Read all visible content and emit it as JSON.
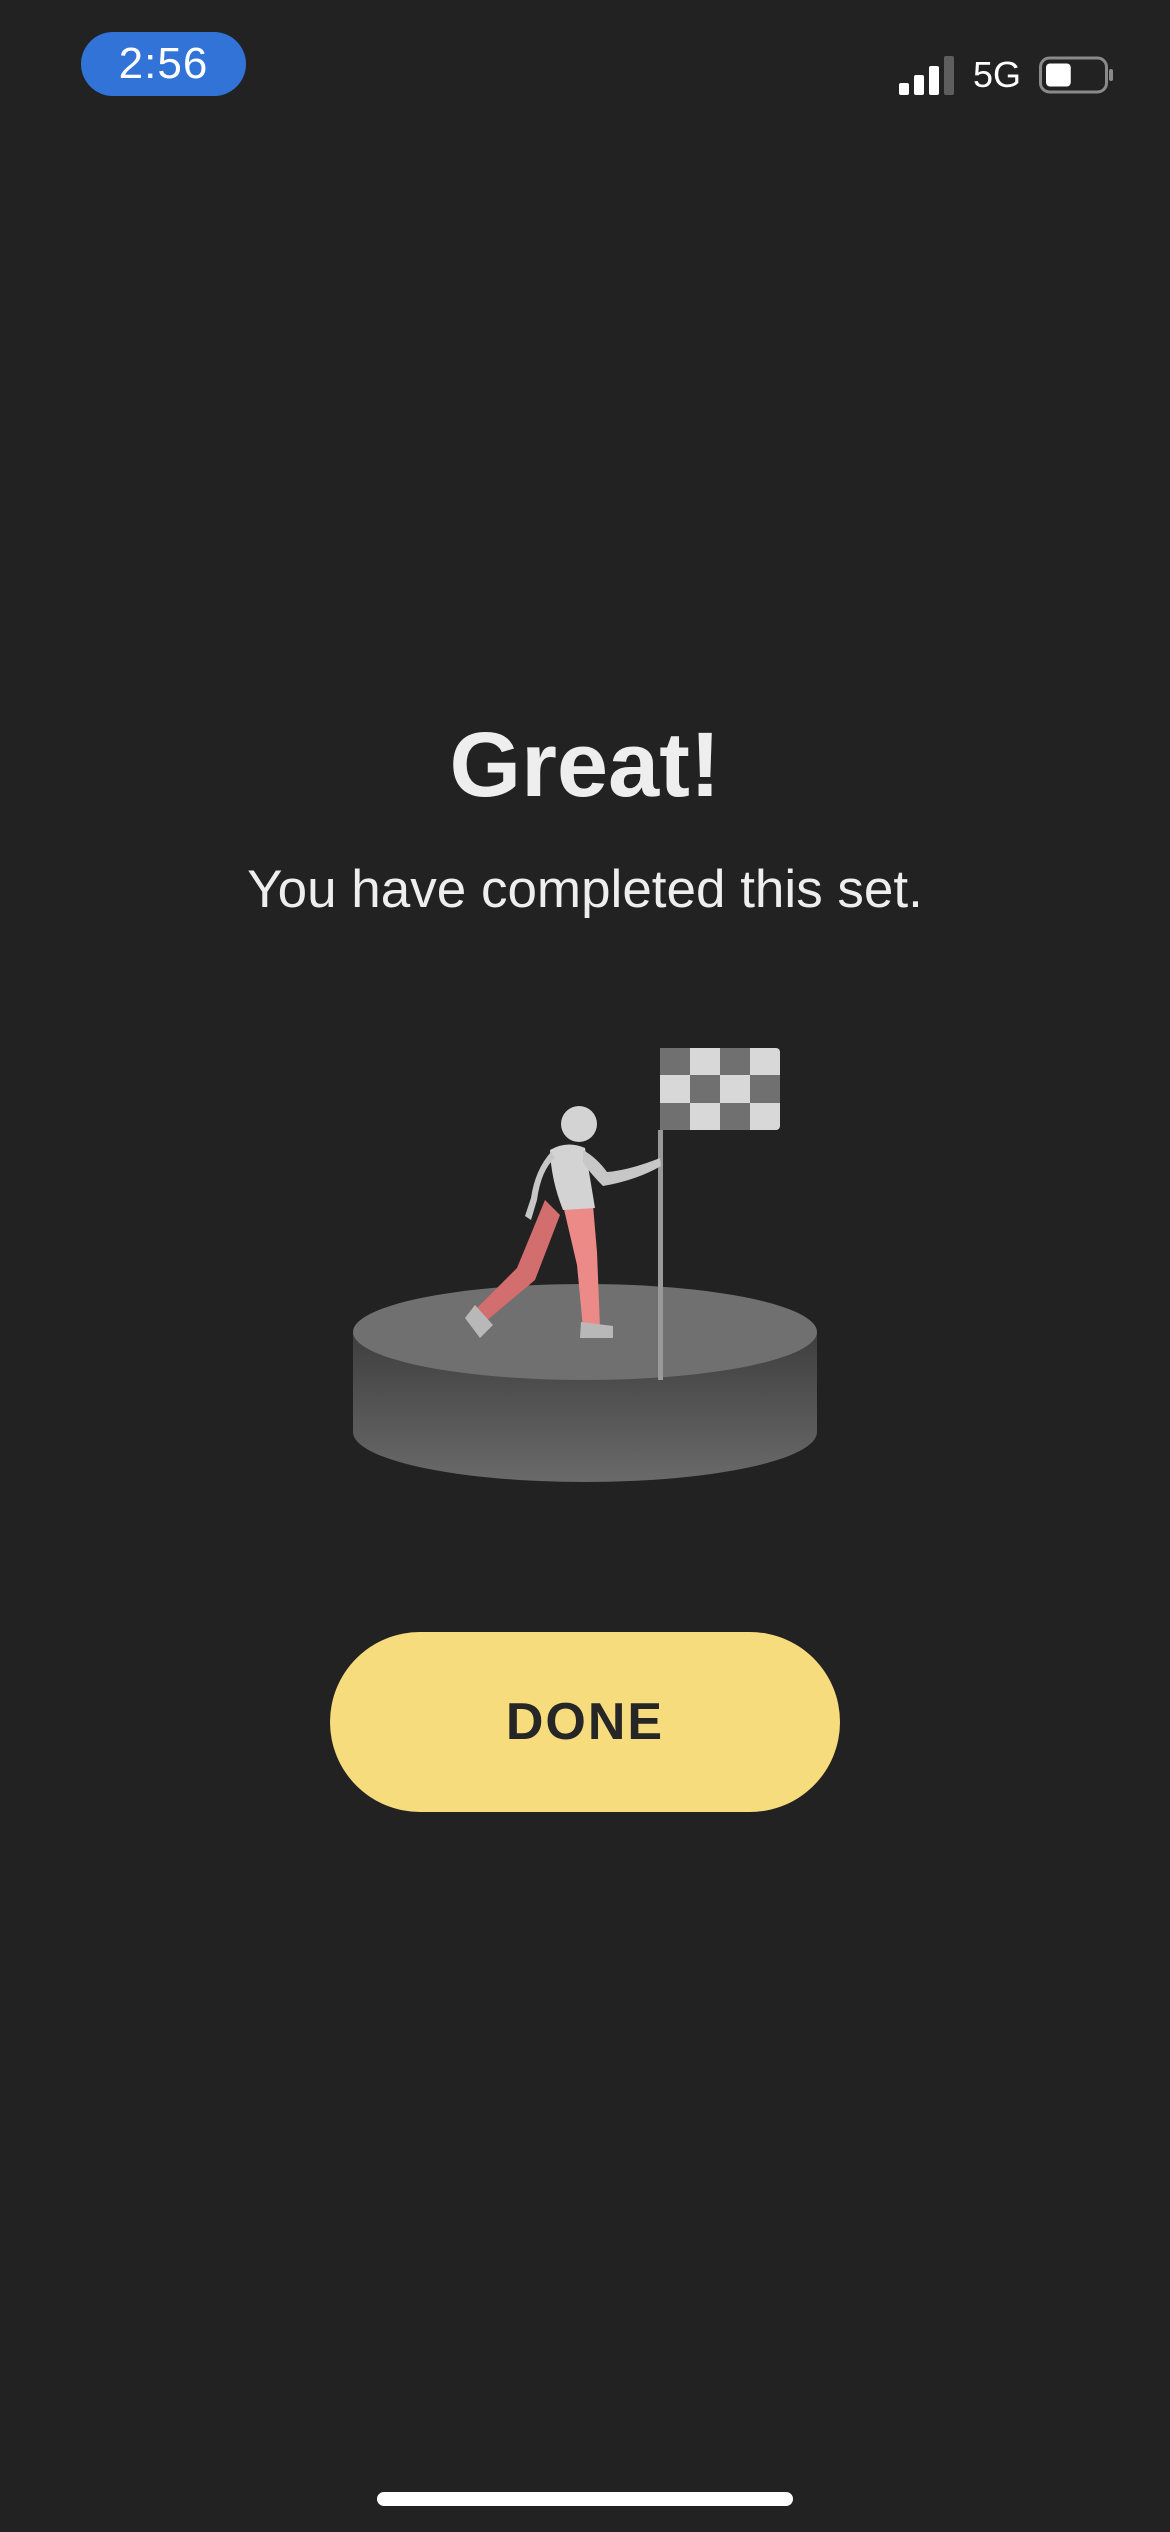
{
  "status_bar": {
    "time": "2:56",
    "network": "5G",
    "signal_bars_active": 3,
    "signal_bars_total": 4,
    "battery_level": 0.45,
    "time_pill_color": "#3273d8"
  },
  "completion": {
    "title": "Great!",
    "message": "You have completed this set."
  },
  "illustration": {
    "icon": "finish-flag-runner-icon"
  },
  "actions": {
    "done_label": "DONE",
    "done_color": "#f7dc7d"
  },
  "theme": {
    "background": "#222222",
    "text": "#eeeeee"
  }
}
